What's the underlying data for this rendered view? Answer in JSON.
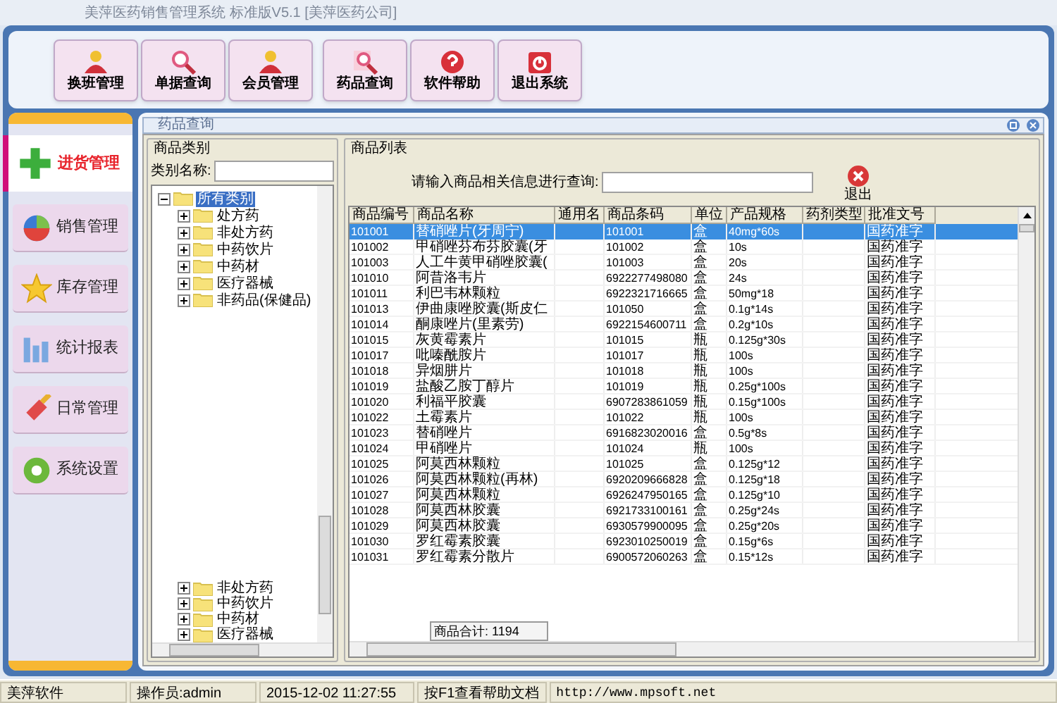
{
  "window": {
    "title": "美萍医药销售管理系统 标准版V5.1 [美萍医药公司]"
  },
  "toolbar": [
    {
      "label": "换班管理"
    },
    {
      "label": "单据查询"
    },
    {
      "label": "会员管理"
    },
    {
      "label": "药品查询"
    },
    {
      "label": "软件帮助"
    },
    {
      "label": "退出系统"
    }
  ],
  "sidebar": {
    "items": [
      {
        "label": "进货管理",
        "selected": true
      },
      {
        "label": "销售管理",
        "selected": false
      },
      {
        "label": "库存管理",
        "selected": false
      },
      {
        "label": "统计报表",
        "selected": false
      },
      {
        "label": "日常管理",
        "selected": false
      },
      {
        "label": "系统设置",
        "selected": false
      }
    ]
  },
  "panel": {
    "title": "药品查询",
    "category_group": {
      "title": "商品类别",
      "filter_label": "类别名称:",
      "tree": [
        {
          "label": "所有类别",
          "selected": true,
          "expanded": true,
          "children": [
            {
              "label": "处方药",
              "selected": false,
              "expanded": false
            },
            {
              "label": "非处方药",
              "selected": false,
              "expanded": false
            },
            {
              "label": "中药饮片",
              "selected": false,
              "expanded": false
            },
            {
              "label": "中药材",
              "selected": false,
              "expanded": false
            },
            {
              "label": "医疗器械",
              "selected": false,
              "expanded": false
            },
            {
              "label": "非药品(保健品)",
              "selected": false,
              "expanded": false
            }
          ]
        }
      ],
      "tree_lower": [
        {
          "label": "非处方药",
          "expanded": false
        },
        {
          "label": "中药饮片",
          "expanded": false
        },
        {
          "label": "中药材",
          "expanded": false
        },
        {
          "label": "医疗器械",
          "expanded": false
        }
      ]
    },
    "list_group": {
      "title": "商品列表",
      "search_label": "请输入商品相关信息进行查询:",
      "exit_button": "退出",
      "table": {
        "columns": [
          "商品编号",
          "商品名称",
          "通用名",
          "商品条码",
          "单位",
          "产品规格",
          "药剂类型",
          "批准文号"
        ],
        "rows": [
          {
            "cells": [
              "101001",
              "替硝唑片(牙周宁)",
              "",
              "101001",
              "盒",
              "40mg*60s",
              "",
              "国药准字"
            ],
            "selected": true
          },
          {
            "cells": [
              "101002",
              "甲硝唑芬布芬胶囊(牙",
              "",
              "101002",
              "盒",
              "10s",
              "",
              "国药准字"
            ],
            "selected": false
          },
          {
            "cells": [
              "101003",
              "人工牛黄甲硝唑胶囊(",
              "",
              "101003",
              "盒",
              "20s",
              "",
              "国药准字"
            ],
            "selected": false
          },
          {
            "cells": [
              "101010",
              "阿昔洛韦片",
              "",
              "6922277498080",
              "盒",
              "24s",
              "",
              "国药准字"
            ],
            "selected": false
          },
          {
            "cells": [
              "101011",
              "利巴韦林颗粒",
              "",
              "6922321716665",
              "盒",
              "50mg*18",
              "",
              "国药准字"
            ],
            "selected": false
          },
          {
            "cells": [
              "101013",
              "伊曲康唑胶囊(斯皮仁",
              "",
              "101050",
              "盒",
              "0.1g*14s",
              "",
              "国药准字"
            ],
            "selected": false
          },
          {
            "cells": [
              "101014",
              "酮康唑片(里素劳)",
              "",
              "6922154600711",
              "盒",
              "0.2g*10s",
              "",
              "国药准字"
            ],
            "selected": false
          },
          {
            "cells": [
              "101015",
              "灰黄霉素片",
              "",
              "101015",
              "瓶",
              "0.125g*30s",
              "",
              "国药准字"
            ],
            "selected": false
          },
          {
            "cells": [
              "101017",
              "吡嗪酰胺片",
              "",
              "101017",
              "瓶",
              "100s",
              "",
              "国药准字"
            ],
            "selected": false
          },
          {
            "cells": [
              "101018",
              "异烟肼片",
              "",
              "101018",
              "瓶",
              "100s",
              "",
              "国药准字"
            ],
            "selected": false
          },
          {
            "cells": [
              "101019",
              "盐酸乙胺丁醇片",
              "",
              "101019",
              "瓶",
              "0.25g*100s",
              "",
              "国药准字"
            ],
            "selected": false
          },
          {
            "cells": [
              "101020",
              "利福平胶囊",
              "",
              "6907283861059",
              "瓶",
              "0.15g*100s",
              "",
              "国药准字"
            ],
            "selected": false
          },
          {
            "cells": [
              "101022",
              "土霉素片",
              "",
              "101022",
              "瓶",
              "100s",
              "",
              "国药准字"
            ],
            "selected": false
          },
          {
            "cells": [
              "101023",
              "替硝唑片",
              "",
              "6916823020016",
              "盒",
              "0.5g*8s",
              "",
              "国药准字"
            ],
            "selected": false
          },
          {
            "cells": [
              "101024",
              "甲硝唑片",
              "",
              "101024",
              "瓶",
              "100s",
              "",
              "国药准字"
            ],
            "selected": false
          },
          {
            "cells": [
              "101025",
              "阿莫西林颗粒",
              "",
              "101025",
              "盒",
              "0.125g*12",
              "",
              "国药准字"
            ],
            "selected": false
          },
          {
            "cells": [
              "101026",
              "阿莫西林颗粒(再林)",
              "",
              "6920209666828",
              "盒",
              "0.125g*18",
              "",
              "国药准字"
            ],
            "selected": false
          },
          {
            "cells": [
              "101027",
              "阿莫西林颗粒",
              "",
              "6926247950165",
              "盒",
              "0.125g*10",
              "",
              "国药准字"
            ],
            "selected": false
          },
          {
            "cells": [
              "101028",
              "阿莫西林胶囊",
              "",
              "6921733100161",
              "盒",
              "0.25g*24s",
              "",
              "国药准字"
            ],
            "selected": false
          },
          {
            "cells": [
              "101029",
              "阿莫西林胶囊",
              "",
              "6930579900095",
              "盒",
              "0.25g*20s",
              "",
              "国药准字"
            ],
            "selected": false
          },
          {
            "cells": [
              "101030",
              "罗红霉素胶囊",
              "",
              "6923010250019",
              "盒",
              "0.15g*6s",
              "",
              "国药准字"
            ],
            "selected": false
          },
          {
            "cells": [
              "101031",
              "罗红霉素分散片",
              "",
              "6900572060263",
              "盒",
              "0.15*12s",
              "",
              "国药准字"
            ],
            "selected": false
          }
        ]
      },
      "total": "商品合计: 1194"
    }
  },
  "status_bar": [
    "美萍软件",
    "操作员:admin",
    "2015-12-02 11:27:55",
    "按F1查看帮助文档",
    "http://www.mpsoft.net"
  ]
}
